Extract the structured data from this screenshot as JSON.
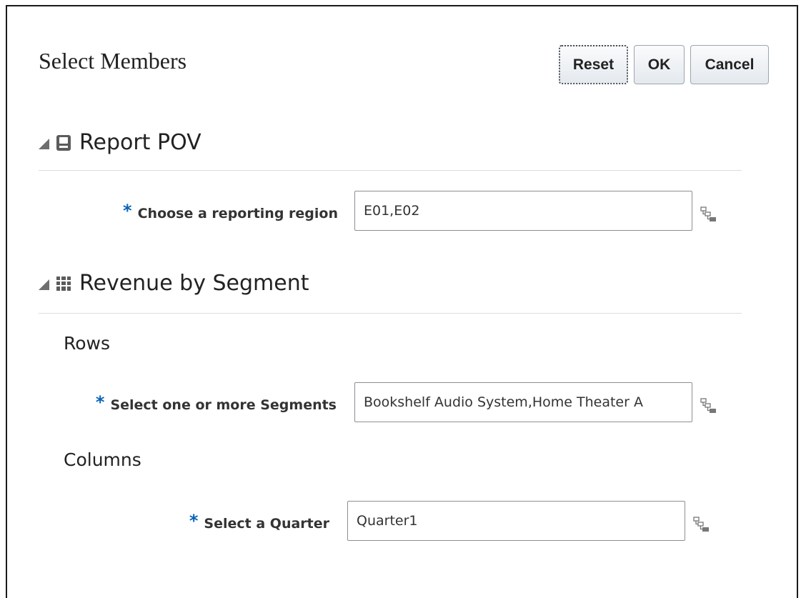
{
  "dialog": {
    "title": "Select Members",
    "buttons": {
      "reset": "Reset",
      "ok": "OK",
      "cancel": "Cancel"
    }
  },
  "report_pov": {
    "heading": "Report POV",
    "icon": "report-icon",
    "fields": [
      {
        "label": "Choose a reporting region",
        "required": true,
        "value": "E01,E02"
      }
    ]
  },
  "revenue_by_segment": {
    "heading": "Revenue by Segment",
    "icon": "grid-icon",
    "rows": {
      "heading": "Rows",
      "fields": [
        {
          "label": "Select one or more Segments",
          "required": true,
          "value": "Bookshelf Audio System,Home Theater A"
        }
      ]
    },
    "columns": {
      "heading": "Columns",
      "fields": [
        {
          "label": "Select a Quarter",
          "required": true,
          "value": "Quarter1"
        }
      ]
    }
  },
  "colors": {
    "required_asterisk": "#0a63b8",
    "border": "#1a1a1a",
    "icon_gray": "#5c5c5c"
  }
}
